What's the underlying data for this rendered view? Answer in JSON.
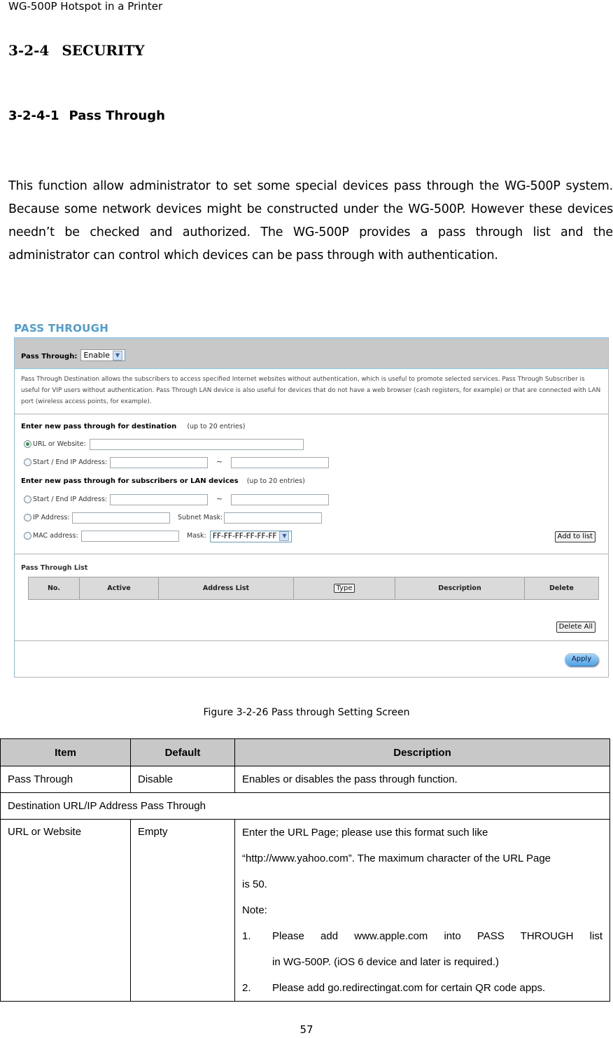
{
  "running_header": "WG-500P Hotspot in a Printer",
  "section": {
    "number": "3-2-4",
    "title": "SECURITY"
  },
  "subsection": {
    "number": "3-2-4-1",
    "title": "Pass Through"
  },
  "intro": "This function allow administrator to set some special devices pass through the WG-500P system. Because some network devices might be constructed under the WG-500P. However these devices needn’t be checked and authorized. The WG-500P provides a pass through list and the administrator can control which devices can be pass through with authentication.",
  "screenshot": {
    "title": "PASS THROUGH",
    "pass_through_label": "Pass Through:",
    "pass_through_value": "Enable",
    "description": "Pass Through Destination allows the subscribers to access specified Internet websites without authentication, which is useful to promote selected services. Pass Through Subscriber is useful for VIP users without authentication. Pass Through LAN device is also useful for devices that do not have a web browser (cash registers, for example) or that are connected with LAN port (wireless access points, for example).",
    "destination": {
      "heading": "Enter new pass through for destination",
      "limit": "(up to 20 entries)",
      "url_label": "URL or Website:",
      "url_value": "",
      "ip_range_label": "Start / End IP Address:",
      "start_ip": "",
      "end_ip": "",
      "range_sep": "~",
      "selected": "url"
    },
    "subscribers": {
      "heading": "Enter new pass through for subscribers or LAN devices",
      "limit": "(up to 20 entries)",
      "ip_range_label": "Start / End IP Address:",
      "range_sep": "~",
      "ip_label": "IP Address:",
      "subnet_label": "Subnet Mask:",
      "mac_label": "MAC address:",
      "mask_label": "Mask:",
      "mask_value": "FF-FF-FF-FF-FF-FF"
    },
    "add_to_list": "Add to list",
    "list": {
      "heading": "Pass Through List",
      "columns": [
        "No.",
        "Active",
        "Address List",
        "Type",
        "Description",
        "Delete"
      ]
    },
    "delete_all": "Delete All",
    "apply": "Apply"
  },
  "caption": "Figure 3-2-26 Pass through Setting Screen",
  "spec_table": {
    "headers": [
      "Item",
      "Default",
      "Description"
    ],
    "rows": [
      {
        "item": "Pass Through",
        "default": "Disable",
        "description": "Enables or disables the pass through function."
      },
      {
        "group": "Destination URL/IP Address Pass Through"
      },
      {
        "item": "URL or Website",
        "default": "Empty",
        "description_lines": [
          "Enter the URL Page; please use this format such like",
          "“http://www.yahoo.com”. The maximum character of the URL Page",
          "is 50.",
          "Note:"
        ],
        "notes": [
          {
            "n": "1.",
            "line1": "Please add www.apple.com into PASS THROUGH list",
            "line2": "in WG-500P. (iOS 6 device and later is required.)"
          },
          {
            "n": "2.",
            "line1": "Please add go.redirectingat.com for certain QR code apps."
          }
        ]
      }
    ]
  },
  "page_number": "57"
}
